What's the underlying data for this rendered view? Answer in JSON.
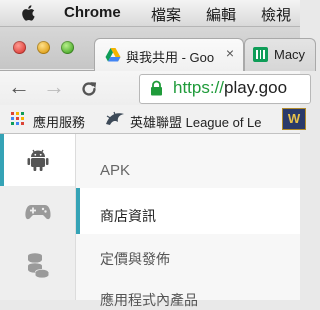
{
  "menubar": {
    "app": "Chrome",
    "file": "檔案",
    "edit": "編輯",
    "view": "檢視"
  },
  "tabs": [
    {
      "title": "與我共用 - Goo",
      "close": "×"
    },
    {
      "title": "Macy"
    }
  ],
  "toolbar": {
    "back": "←",
    "forward": "→",
    "reload": "C",
    "url_scheme": "https://",
    "url_host": "play.goo"
  },
  "bookmarks": [
    {
      "label": "應用服務"
    },
    {
      "label": "英雄聯盟 League of Le"
    },
    {
      "label": "W"
    }
  ],
  "sidebar": {
    "items": [
      {
        "icon": "android-icon",
        "active": true
      },
      {
        "icon": "gamepad-icon",
        "active": false
      },
      {
        "icon": "coins-icon",
        "active": false
      }
    ]
  },
  "menu": {
    "section": "APK",
    "items": [
      {
        "label": "商店資訊",
        "active": true
      },
      {
        "label": "定價與發佈",
        "active": false
      },
      {
        "label": "應用程式內產品",
        "active": false
      }
    ]
  },
  "colors": {
    "accent": "#35a3b6",
    "secure_green": "#1f9b3a"
  }
}
